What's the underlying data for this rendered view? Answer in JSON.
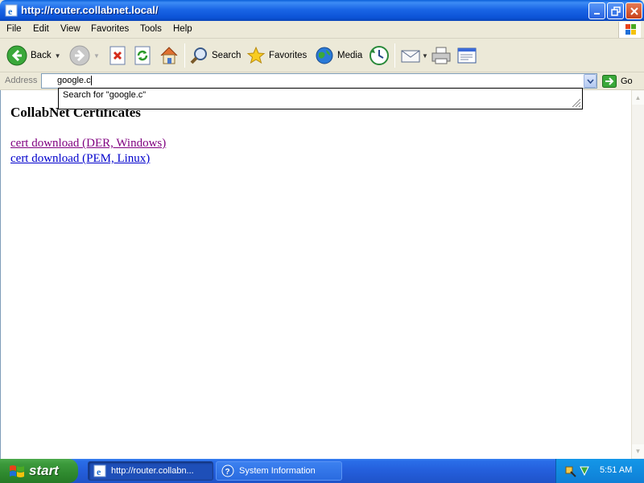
{
  "window": {
    "title": "http://router.collabnet.local/"
  },
  "menu": [
    "File",
    "Edit",
    "View",
    "Favorites",
    "Tools",
    "Help"
  ],
  "toolbar": {
    "back_label": "Back",
    "search_label": "Search",
    "favorites_label": "Favorites",
    "media_label": "Media"
  },
  "address": {
    "label": "Address",
    "value": "google.c",
    "go_label": "Go"
  },
  "autocomplete": {
    "suggestion": "Search for \"google.c\""
  },
  "page": {
    "title": "CollabNet Certificates",
    "links": [
      "cert download (DER, Windows)",
      "cert download (PEM, Linux)"
    ]
  },
  "taskbar": {
    "start_label": "start",
    "tasks": [
      "http://router.collabn...",
      "System Information"
    ],
    "clock": "5:51 AM"
  },
  "colors": {
    "titlebar": "#0b52d6",
    "visited_link": "#800080",
    "link": "#0000cc",
    "start_button": "#3c9a3c"
  }
}
